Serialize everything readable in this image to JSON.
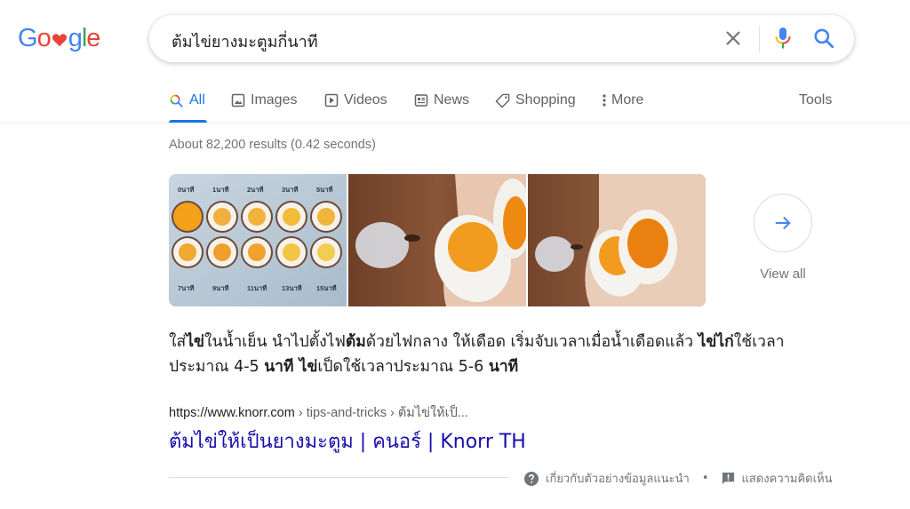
{
  "header": {
    "logo_letters": [
      "G",
      "o",
      "",
      "g",
      "l",
      "e"
    ],
    "logo_colors": [
      "#4285f4",
      "#ea4335",
      "#ea4335",
      "#4285f4",
      "#34a853",
      "#ea4335"
    ],
    "search_query": "ต้มไข่ยางมะตูมกี่นาที",
    "icons": {
      "clear": "close-icon",
      "mic": "microphone-icon",
      "search": "search-icon"
    }
  },
  "tabs": [
    {
      "label": "All",
      "icon": "search-icon",
      "active": true
    },
    {
      "label": "Images",
      "icon": "image-icon",
      "active": false
    },
    {
      "label": "Videos",
      "icon": "play-icon",
      "active": false
    },
    {
      "label": "News",
      "icon": "news-icon",
      "active": false
    },
    {
      "label": "Shopping",
      "icon": "tag-icon",
      "active": false
    },
    {
      "label": "More",
      "icon": "more-vert-icon",
      "active": false
    }
  ],
  "tools_label": "Tools",
  "stats": "About 82,200 results (0.42 seconds)",
  "images": {
    "egg_chart_labels_top": [
      "0นาที",
      "1นาที",
      "2นาที",
      "3นาที",
      "5นาที"
    ],
    "egg_chart_labels_bottom": [
      "7นาที",
      "9นาที",
      "11นาที",
      "13นาที",
      "15นาที"
    ],
    "view_all_label": "View all"
  },
  "snippet": {
    "parts": [
      {
        "text": "ใส่",
        "bold": false
      },
      {
        "text": "ไข่",
        "bold": true
      },
      {
        "text": "ในน้ำเย็น นำไปตั้งไฟ",
        "bold": false
      },
      {
        "text": "ต้ม",
        "bold": true
      },
      {
        "text": "ด้วยไฟกลาง ให้เดือด เริ่มจับเวลาเมื่อน้ำเดือดแล้ว ",
        "bold": false
      },
      {
        "text": "ไข่ไก่",
        "bold": true
      },
      {
        "text": "ใช้เวลาประมาณ 4-5 ",
        "bold": false
      },
      {
        "text": "นาที ไข่",
        "bold": true
      },
      {
        "text": "เป็ดใช้เวลาประมาณ 5-6 ",
        "bold": false
      },
      {
        "text": "นาที",
        "bold": true
      }
    ]
  },
  "result": {
    "cite_domain": "https://www.knorr.com",
    "cite_path": " › tips-and-tricks › ต้มไข่ให้เป็...",
    "title": "ต้มไข่ให้เป็นยางมะตูม | คนอร์ | Knorr TH"
  },
  "feedback": {
    "about_label": "เกี่ยวกับตัวอย่างข้อมูลแนะนำ",
    "separator": "•",
    "feedback_label": "แสดงความคิดเห็น"
  }
}
